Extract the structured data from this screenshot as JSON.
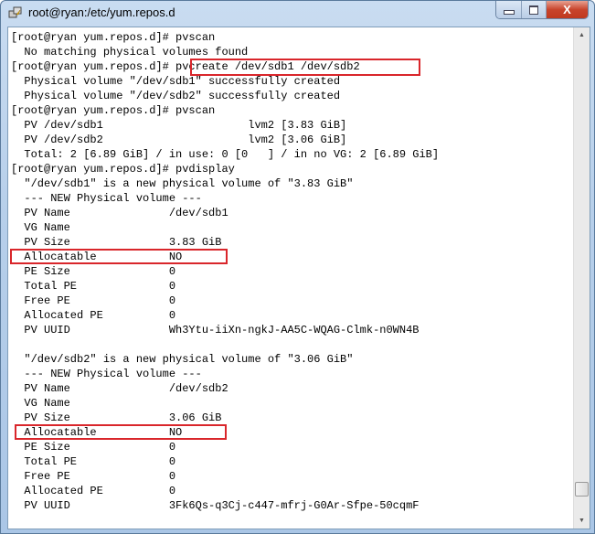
{
  "window": {
    "title": "root@ryan:/etc/yum.repos.d",
    "controls": {
      "minimize": "minimize",
      "maximize": "maximize",
      "close": "X"
    }
  },
  "terminal": {
    "lines": [
      "[root@ryan yum.repos.d]# pvscan",
      "  No matching physical volumes found",
      "[root@ryan yum.repos.d]# pvcreate /dev/sdb1 /dev/sdb2",
      "  Physical volume \"/dev/sdb1\" successfully created",
      "  Physical volume \"/dev/sdb2\" successfully created",
      "[root@ryan yum.repos.d]# pvscan",
      "  PV /dev/sdb1                      lvm2 [3.83 GiB]",
      "  PV /dev/sdb2                      lvm2 [3.06 GiB]",
      "  Total: 2 [6.89 GiB] / in use: 0 [0   ] / in no VG: 2 [6.89 GiB]",
      "[root@ryan yum.repos.d]# pvdisplay",
      "  \"/dev/sdb1\" is a new physical volume of \"3.83 GiB\"",
      "  --- NEW Physical volume ---",
      "  PV Name               /dev/sdb1",
      "  VG Name",
      "  PV Size               3.83 GiB",
      "  Allocatable           NO",
      "  PE Size               0",
      "  Total PE              0",
      "  Free PE               0",
      "  Allocated PE          0",
      "  PV UUID               Wh3Ytu-iiXn-ngkJ-AA5C-WQAG-Clmk-n0WN4B",
      "",
      "  \"/dev/sdb2\" is a new physical volume of \"3.06 GiB\"",
      "  --- NEW Physical volume ---",
      "  PV Name               /dev/sdb2",
      "  VG Name",
      "  PV Size               3.06 GiB",
      "  Allocatable           NO",
      "  PE Size               0",
      "  Total PE              0",
      "  Free PE               0",
      "  Allocated PE          0",
      "  PV UUID               3Fk6Qs-q3Cj-c447-mfrj-G0Ar-Sfpe-50cqmF"
    ]
  },
  "annotations": {
    "highlight_color": "#d9262b",
    "highlighted_items": [
      "pvcreate /dev/sdb1 /dev/sdb2",
      "Allocatable NO (sdb1)",
      "Allocatable NO (sdb2)"
    ]
  },
  "scrollbar": {
    "up_arrow": "▲",
    "down_arrow": "▼"
  }
}
